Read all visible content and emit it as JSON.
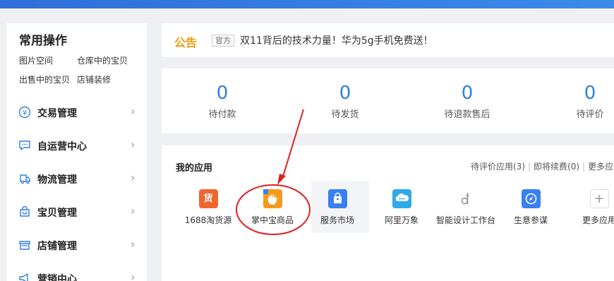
{
  "sidebar": {
    "title": "常用操作",
    "quick_links": [
      "图片空间",
      "仓库中的宝贝",
      "出售中的宝贝",
      "店铺装修"
    ],
    "menu": [
      {
        "label": "交易管理",
        "icon": "yuan-circle-icon"
      },
      {
        "label": "自运营中心",
        "icon": "chat-bubble-icon"
      },
      {
        "label": "物流管理",
        "icon": "truck-icon"
      },
      {
        "label": "宝贝管理",
        "icon": "bag-icon"
      },
      {
        "label": "店铺管理",
        "icon": "store-icon"
      },
      {
        "label": "营销中心",
        "icon": "megaphone-icon"
      }
    ],
    "arrow": "›"
  },
  "notice": {
    "label": "公告",
    "tag": "官方",
    "text": "双11背后的技术力量！华为5g手机免费送！"
  },
  "stats": [
    {
      "value": "0",
      "label": "待付款"
    },
    {
      "value": "0",
      "label": "待发货"
    },
    {
      "value": "0",
      "label": "待退款售后"
    },
    {
      "value": "0",
      "label": "待评价"
    }
  ],
  "apps": {
    "title": "我的应用",
    "links": [
      "待评价应用(3)",
      "即将续费(0)",
      "更多应"
    ],
    "items": [
      {
        "label": "1688淘货源",
        "icon": "taohuoyuan-icon",
        "color": "#f0652f",
        "glyph": "货"
      },
      {
        "label": "掌中宝商品",
        "icon": "palm-hand-icon",
        "color": "#f59a1b",
        "glyph": "✋"
      },
      {
        "label": "服务市场",
        "icon": "shopping-bag-icon",
        "color": "#3a7ff0",
        "glyph": "🛍"
      },
      {
        "label": "阿里万象",
        "icon": "cloud-chat-icon",
        "color": "#2eaae8",
        "glyph": "☁"
      },
      {
        "label": "智能设计工作台",
        "icon": "design-d-icon",
        "color": "#ffffff",
        "glyph": "d"
      },
      {
        "label": "生意参谋",
        "icon": "compass-icon",
        "color": "#3a7ff0",
        "glyph": "◈"
      },
      {
        "label": "更多应用",
        "icon": "plus-icon",
        "color": "#ffffff",
        "glyph": "+"
      }
    ]
  }
}
